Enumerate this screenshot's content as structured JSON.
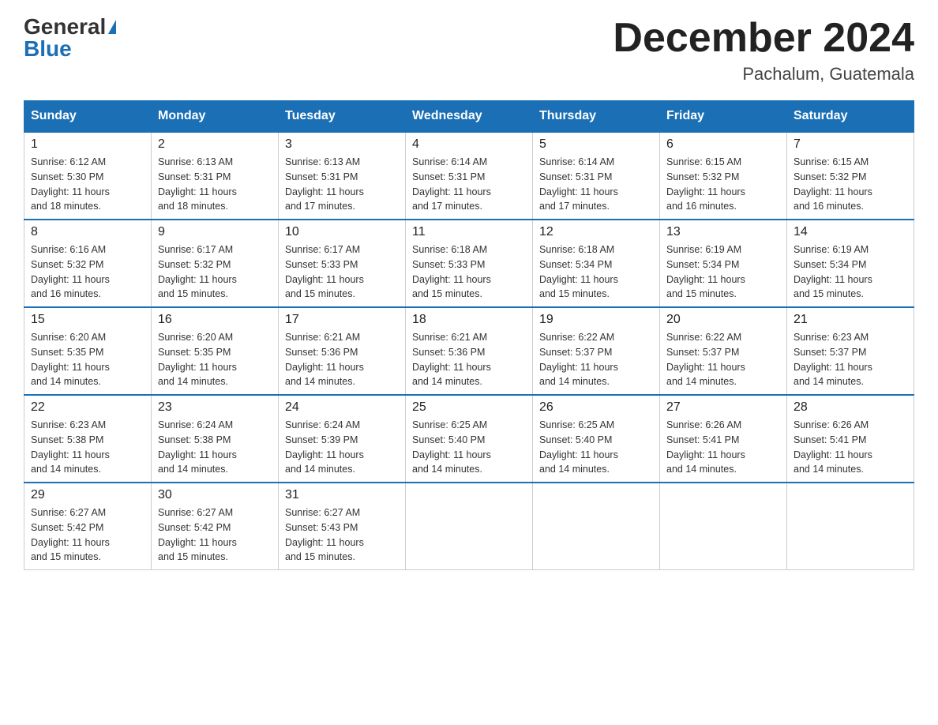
{
  "header": {
    "logo_general": "General",
    "logo_blue": "Blue",
    "month_title": "December 2024",
    "location": "Pachalum, Guatemala"
  },
  "weekdays": [
    "Sunday",
    "Monday",
    "Tuesday",
    "Wednesday",
    "Thursday",
    "Friday",
    "Saturday"
  ],
  "weeks": [
    [
      {
        "day": "1",
        "sunrise": "6:12 AM",
        "sunset": "5:30 PM",
        "daylight": "11 hours and 18 minutes."
      },
      {
        "day": "2",
        "sunrise": "6:13 AM",
        "sunset": "5:31 PM",
        "daylight": "11 hours and 18 minutes."
      },
      {
        "day": "3",
        "sunrise": "6:13 AM",
        "sunset": "5:31 PM",
        "daylight": "11 hours and 17 minutes."
      },
      {
        "day": "4",
        "sunrise": "6:14 AM",
        "sunset": "5:31 PM",
        "daylight": "11 hours and 17 minutes."
      },
      {
        "day": "5",
        "sunrise": "6:14 AM",
        "sunset": "5:31 PM",
        "daylight": "11 hours and 17 minutes."
      },
      {
        "day": "6",
        "sunrise": "6:15 AM",
        "sunset": "5:32 PM",
        "daylight": "11 hours and 16 minutes."
      },
      {
        "day": "7",
        "sunrise": "6:15 AM",
        "sunset": "5:32 PM",
        "daylight": "11 hours and 16 minutes."
      }
    ],
    [
      {
        "day": "8",
        "sunrise": "6:16 AM",
        "sunset": "5:32 PM",
        "daylight": "11 hours and 16 minutes."
      },
      {
        "day": "9",
        "sunrise": "6:17 AM",
        "sunset": "5:32 PM",
        "daylight": "11 hours and 15 minutes."
      },
      {
        "day": "10",
        "sunrise": "6:17 AM",
        "sunset": "5:33 PM",
        "daylight": "11 hours and 15 minutes."
      },
      {
        "day": "11",
        "sunrise": "6:18 AM",
        "sunset": "5:33 PM",
        "daylight": "11 hours and 15 minutes."
      },
      {
        "day": "12",
        "sunrise": "6:18 AM",
        "sunset": "5:34 PM",
        "daylight": "11 hours and 15 minutes."
      },
      {
        "day": "13",
        "sunrise": "6:19 AM",
        "sunset": "5:34 PM",
        "daylight": "11 hours and 15 minutes."
      },
      {
        "day": "14",
        "sunrise": "6:19 AM",
        "sunset": "5:34 PM",
        "daylight": "11 hours and 15 minutes."
      }
    ],
    [
      {
        "day": "15",
        "sunrise": "6:20 AM",
        "sunset": "5:35 PM",
        "daylight": "11 hours and 14 minutes."
      },
      {
        "day": "16",
        "sunrise": "6:20 AM",
        "sunset": "5:35 PM",
        "daylight": "11 hours and 14 minutes."
      },
      {
        "day": "17",
        "sunrise": "6:21 AM",
        "sunset": "5:36 PM",
        "daylight": "11 hours and 14 minutes."
      },
      {
        "day": "18",
        "sunrise": "6:21 AM",
        "sunset": "5:36 PM",
        "daylight": "11 hours and 14 minutes."
      },
      {
        "day": "19",
        "sunrise": "6:22 AM",
        "sunset": "5:37 PM",
        "daylight": "11 hours and 14 minutes."
      },
      {
        "day": "20",
        "sunrise": "6:22 AM",
        "sunset": "5:37 PM",
        "daylight": "11 hours and 14 minutes."
      },
      {
        "day": "21",
        "sunrise": "6:23 AM",
        "sunset": "5:37 PM",
        "daylight": "11 hours and 14 minutes."
      }
    ],
    [
      {
        "day": "22",
        "sunrise": "6:23 AM",
        "sunset": "5:38 PM",
        "daylight": "11 hours and 14 minutes."
      },
      {
        "day": "23",
        "sunrise": "6:24 AM",
        "sunset": "5:38 PM",
        "daylight": "11 hours and 14 minutes."
      },
      {
        "day": "24",
        "sunrise": "6:24 AM",
        "sunset": "5:39 PM",
        "daylight": "11 hours and 14 minutes."
      },
      {
        "day": "25",
        "sunrise": "6:25 AM",
        "sunset": "5:40 PM",
        "daylight": "11 hours and 14 minutes."
      },
      {
        "day": "26",
        "sunrise": "6:25 AM",
        "sunset": "5:40 PM",
        "daylight": "11 hours and 14 minutes."
      },
      {
        "day": "27",
        "sunrise": "6:26 AM",
        "sunset": "5:41 PM",
        "daylight": "11 hours and 14 minutes."
      },
      {
        "day": "28",
        "sunrise": "6:26 AM",
        "sunset": "5:41 PM",
        "daylight": "11 hours and 14 minutes."
      }
    ],
    [
      {
        "day": "29",
        "sunrise": "6:27 AM",
        "sunset": "5:42 PM",
        "daylight": "11 hours and 15 minutes."
      },
      {
        "day": "30",
        "sunrise": "6:27 AM",
        "sunset": "5:42 PM",
        "daylight": "11 hours and 15 minutes."
      },
      {
        "day": "31",
        "sunrise": "6:27 AM",
        "sunset": "5:43 PM",
        "daylight": "11 hours and 15 minutes."
      },
      null,
      null,
      null,
      null
    ]
  ],
  "labels": {
    "sunrise": "Sunrise:",
    "sunset": "Sunset:",
    "daylight": "Daylight:"
  }
}
